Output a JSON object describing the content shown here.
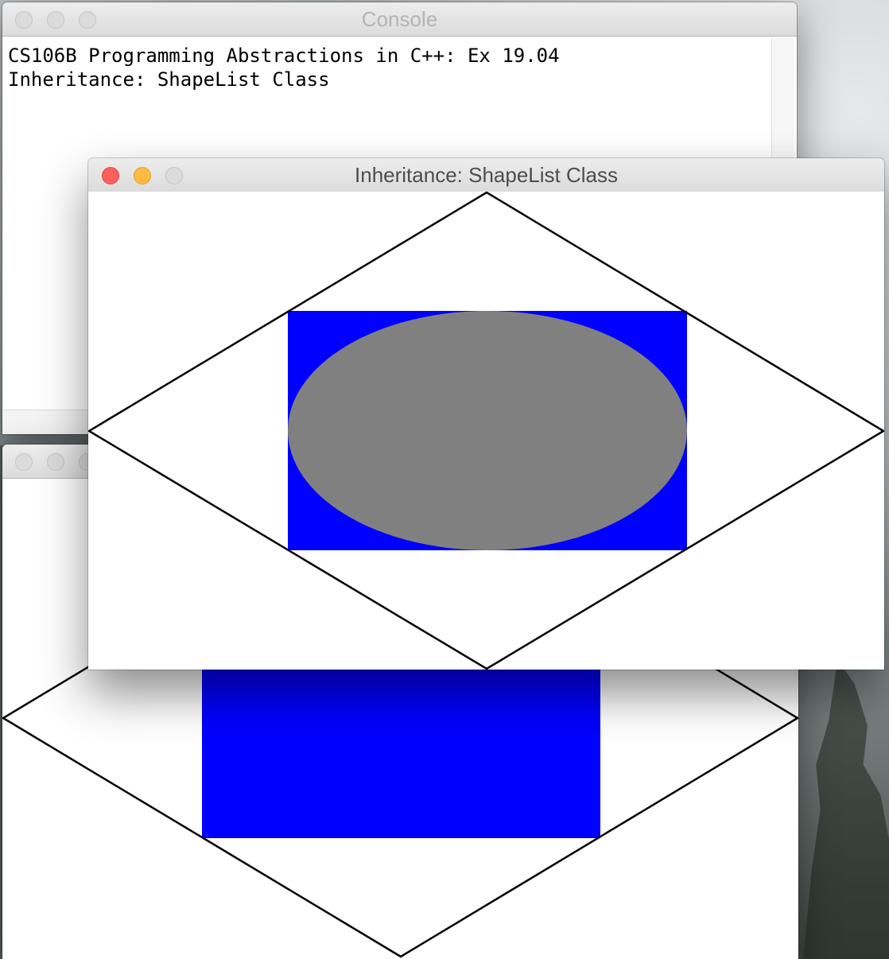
{
  "console_window": {
    "title": "Console",
    "lines": [
      "CS106B Programming Abstractions in C++: Ex 19.04",
      "Inheritance: ShapeList Class"
    ]
  },
  "graphics_window": {
    "title": "Inheritance: ShapeList Class",
    "shapes": [
      {
        "kind": "diamond",
        "stroke": "#000000",
        "fill": "none"
      },
      {
        "kind": "rectangle",
        "fill": "#0000ff"
      },
      {
        "kind": "oval",
        "fill": "#808080"
      }
    ]
  },
  "background_window": {
    "title": "",
    "shapes": [
      {
        "kind": "diamond",
        "stroke": "#000000",
        "fill": "none"
      },
      {
        "kind": "rectangle",
        "fill": "#0000ff"
      }
    ]
  },
  "colors": {
    "close": "#fc605b",
    "minimize": "#fdbc40",
    "inactive_button": "#dcdcdc",
    "rect_blue": "#0000ff",
    "oval_grey": "#808080"
  }
}
